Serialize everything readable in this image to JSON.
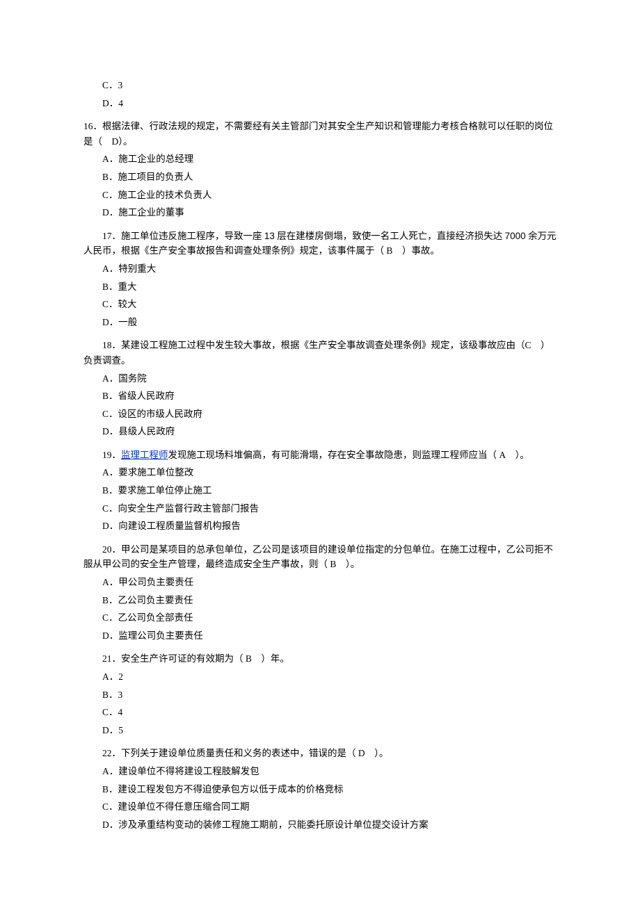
{
  "partial15": {
    "c": "C．3",
    "d": "D．4"
  },
  "q16": {
    "stem": "16．根据法律、行政法规的规定，不需要经有关主管部门对其安全生产知识和管理能力考核合格就可以任职的岗位是（ D）。",
    "a": "A．施工企业的总经理",
    "b": "B．施工项目的负责人",
    "c": "C．施工企业的技术负责人",
    "d": "D．施工企业的董事"
  },
  "q17": {
    "stem_a": "17．施工单位违反施工程序，导致一座 ",
    "stem_num": "13",
    "stem_b": " 层在建楼房倒塌，致使一名工人死亡，直接经济损失达 ",
    "stem_num2": "7000",
    "stem_c": " 余万元人民币，根据《生产安全事故报告和调查处理条例》规定，该事件属于（ B ）事故。",
    "a": "A．特别重大",
    "b": "B．重大",
    "c": "C．较大",
    "d": "D．一般"
  },
  "q18": {
    "stem": "18．某建设工程施工过程中发生较大事故，根据《生产安全事故调查处理条例》规定，该级事故应由（C ）负责调查。",
    "a": "A．国务院",
    "b": "B．省级人民政府",
    "c": "C．设区的市级人民政府",
    "d": "D．县级人民政府"
  },
  "q19": {
    "pre": "19．",
    "link": "监理工程师",
    "post": "发现施工现场料堆偏高，有可能滑塌，存在安全事故隐患，则监理工程师应当（ A ）。",
    "a": "A．要求施工单位整改",
    "b": "B．要求施工单位停止施工",
    "c": "C．向安全生产监督行政主管部门报告",
    "d": "D．向建设工程质量监督机构报告"
  },
  "q20": {
    "stem": "20．甲公司是某项目的总承包单位，乙公司是该项目的建设单位指定的分包单位。在施工过程中，乙公司拒不服从甲公司的安全生产管理，最终造成安全生产事故，则（ B ）。",
    "a": "A．甲公司负主要责任",
    "b": "B．乙公司负主要责任",
    "c": "C．乙公司负全部责任",
    "d": "D．监理公司负主要责任"
  },
  "q21": {
    "stem": "21．安全生产许可证的有效期为（ B ）年。",
    "a": "A．2",
    "b": "B．3",
    "c": "C．4",
    "d": "D．5"
  },
  "q22": {
    "stem": "22．下列关于建设单位质量责任和义务的表述中，错误的是（ D ）。",
    "a": "A．建设单位不得将建设工程肢解发包",
    "b": "B．建设工程发包方不得迫使承包方以低于成本的价格竞标",
    "c": "C．建设单位不得任意压缩合同工期",
    "d": "D．涉及承重结构变动的装修工程施工期前，只能委托原设计单位提交设计方案"
  }
}
